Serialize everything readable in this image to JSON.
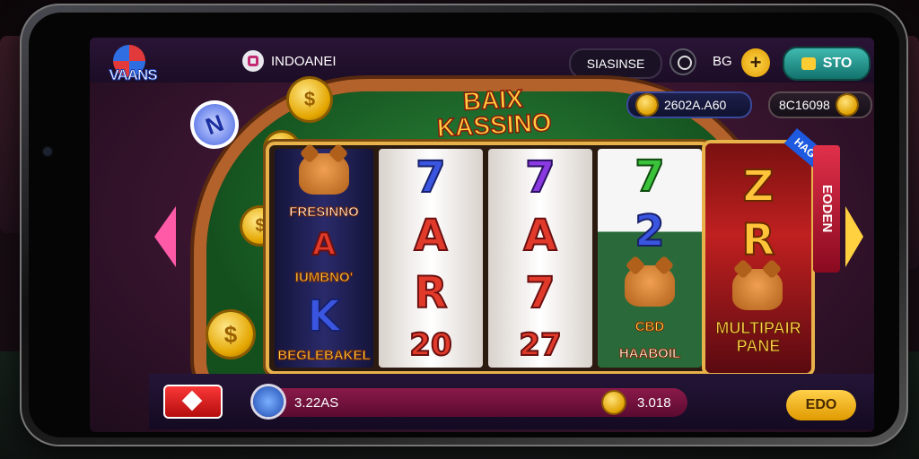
{
  "app": {
    "logo_text": "VAANS",
    "user_name": "INDOANEI",
    "status_text": "SIASINSE",
    "count_label": "BG",
    "store_label": "STO"
  },
  "balances": {
    "primary": "2602A.A60",
    "secondary": "8C16098"
  },
  "game": {
    "title_line1": "BAIX",
    "title_line2": "KASSINO",
    "chip_label": "N",
    "reels": [
      {
        "symbols": [
          "FRESINNO",
          "A",
          "IUMBNO'",
          "K",
          "BEGLEBAKEL"
        ]
      },
      {
        "symbols": [
          "7",
          "A",
          "R",
          "20"
        ]
      },
      {
        "symbols": [
          "7",
          "A",
          "7",
          "27"
        ]
      },
      {
        "symbols": [
          "7",
          "2",
          "CBD",
          "HAABOIL"
        ]
      }
    ],
    "feature": {
      "badge": "HAG",
      "side_tab": "EODEN",
      "symbols": [
        "Z",
        "R"
      ],
      "label_line1": "MULTIPAIR",
      "label_line2": "PANE"
    }
  },
  "bottom": {
    "balance": "3.22AS",
    "win": "3.018",
    "spin_label": "EDO"
  },
  "colors": {
    "accent_gold": "#ffd040",
    "accent_pink": "#ff5aa8",
    "bet_red": "#e22a2a",
    "store_teal": "#3fb9b0"
  },
  "icons": {
    "logo": "brand-logo",
    "user": "user-icon",
    "lang": "globe-icon",
    "plus": "plus-icon",
    "store": "store-icon",
    "coin": "coin-icon",
    "bet": "diamond-icon",
    "menu": "menu-icon"
  }
}
